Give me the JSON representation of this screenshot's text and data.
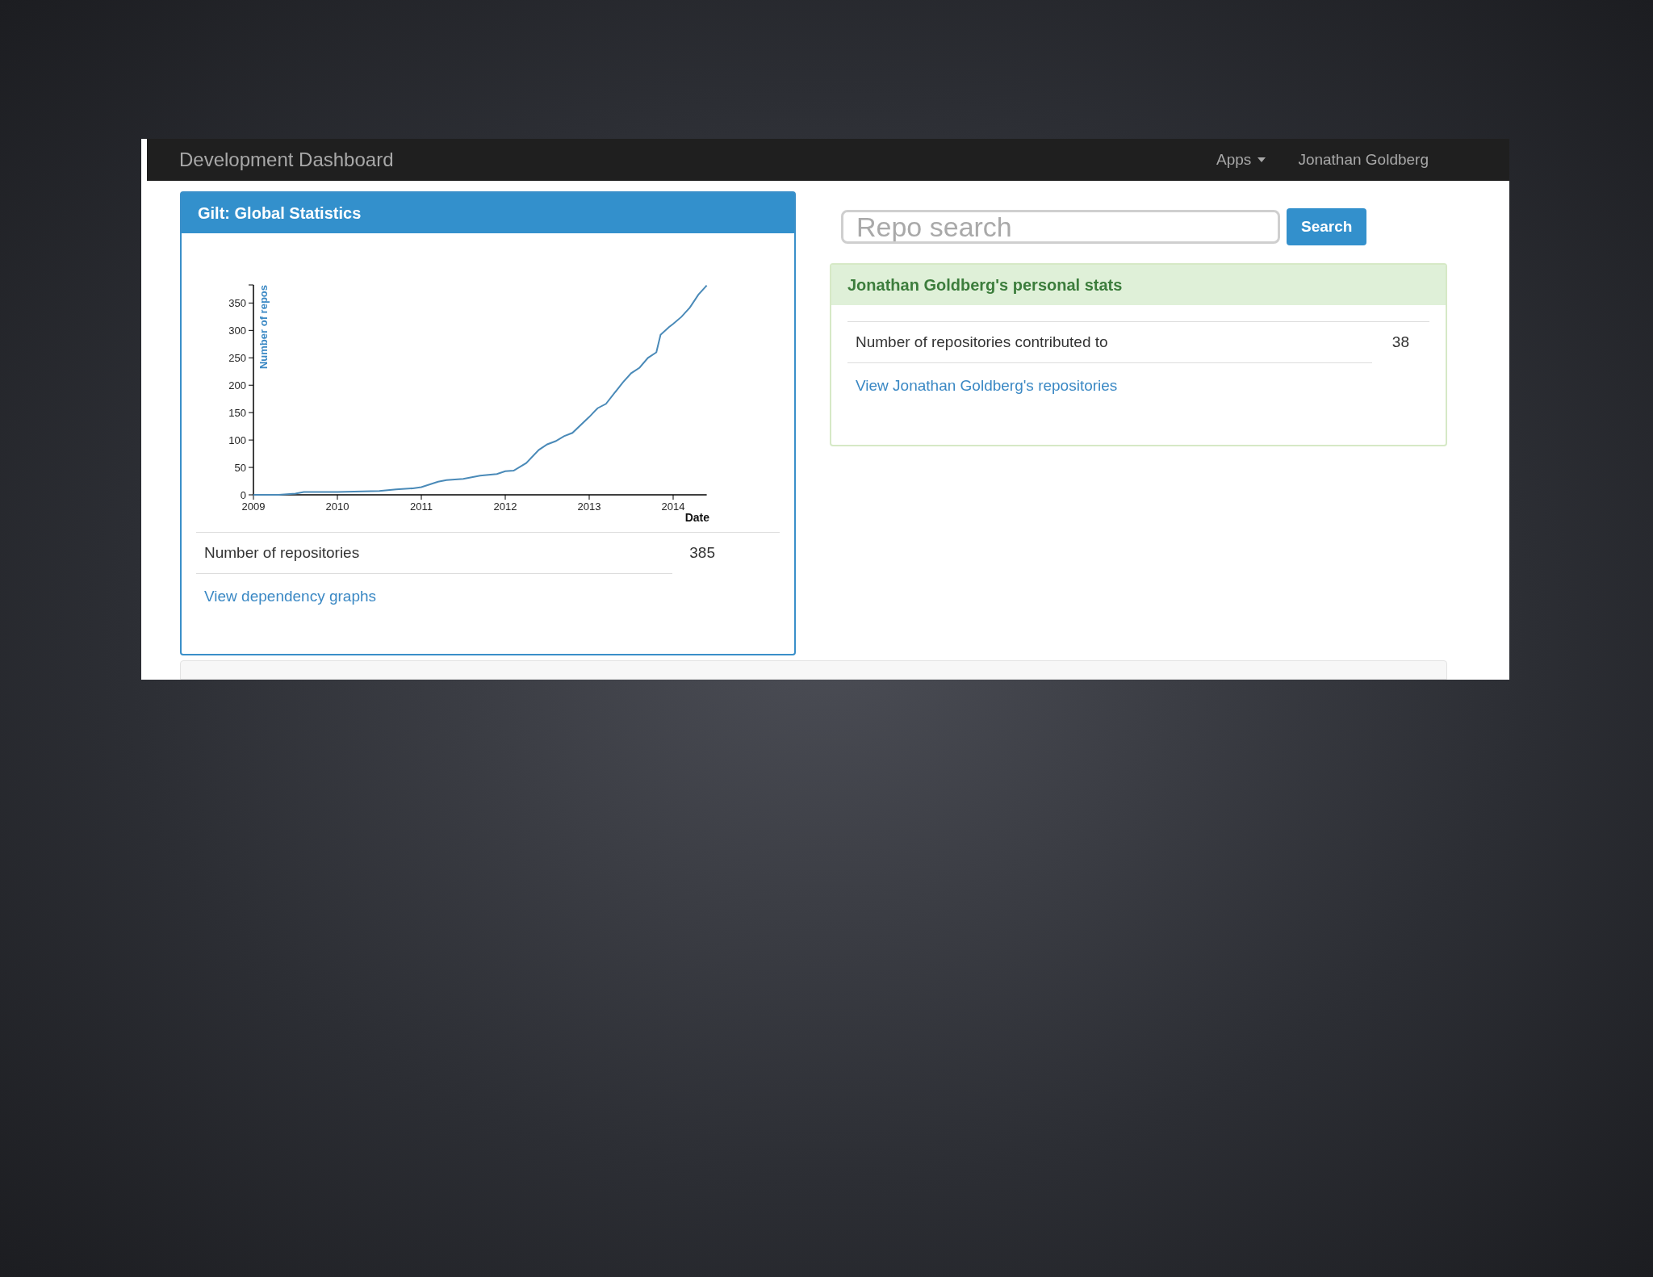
{
  "navbar": {
    "brand": "Development Dashboard",
    "menu": [
      {
        "label": "Apps",
        "kind": "dropdown"
      },
      {
        "label": "Jonathan Goldberg",
        "kind": "link"
      }
    ]
  },
  "global_panel": {
    "title": "Gilt: Global Statistics",
    "chart_data": {
      "type": "line",
      "xlabel": "Date",
      "ylabel": "Number of repos",
      "x": [
        2009,
        2009.3,
        2009.5,
        2009.6,
        2010,
        2010.2,
        2010.5,
        2010.7,
        2010.9,
        2011,
        2011.2,
        2011.3,
        2011.5,
        2011.7,
        2011.9,
        2012,
        2012.1,
        2012.25,
        2012.4,
        2012.5,
        2012.6,
        2012.7,
        2012.8,
        2013,
        2013.1,
        2013.2,
        2013.4,
        2013.5,
        2013.6,
        2013.7,
        2013.8,
        2013.85,
        2013.95,
        2014,
        2014.1,
        2014.2,
        2014.3,
        2014.4
      ],
      "series": [
        {
          "color": "#4a8ab8",
          "values": [
            0,
            0,
            2,
            5,
            5,
            6,
            7,
            10,
            12,
            14,
            24,
            27,
            29,
            35,
            38,
            43,
            44,
            58,
            82,
            92,
            98,
            107,
            113,
            142,
            158,
            166,
            205,
            222,
            232,
            250,
            260,
            292,
            306,
            312,
            325,
            342,
            365,
            382
          ]
        }
      ],
      "xlim": [
        2009,
        2014.4
      ],
      "ylim": [
        0,
        383
      ],
      "xticks": [
        2009,
        2010,
        2011,
        2012,
        2013,
        2014
      ],
      "yticks": [
        0,
        50,
        100,
        150,
        200,
        250,
        300,
        350
      ]
    },
    "rows": [
      {
        "label": "Number of repositories",
        "value": "385"
      }
    ],
    "link": "View dependency graphs"
  },
  "search": {
    "placeholder": "Repo search",
    "button": "Search"
  },
  "personal_panel": {
    "title": "Jonathan Goldberg's personal stats",
    "rows": [
      {
        "label": "Number of repositories contributed to",
        "value": "38"
      }
    ],
    "link": "View Jonathan Goldberg's repositories"
  }
}
